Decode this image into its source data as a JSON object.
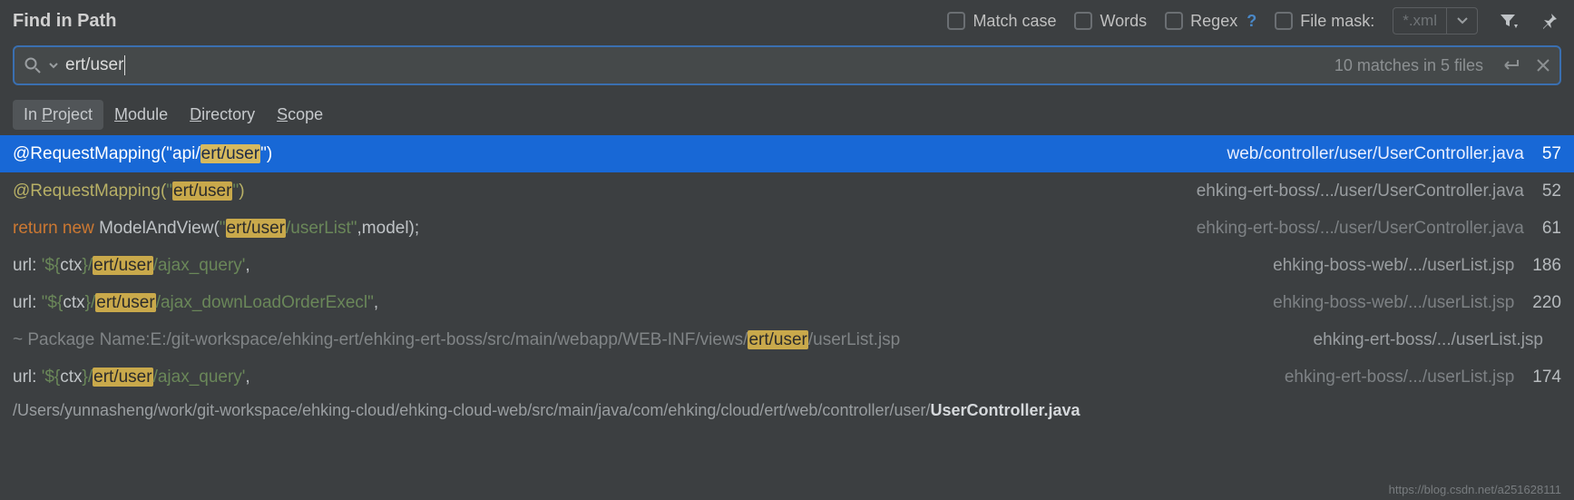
{
  "title": "Find in Path",
  "options": {
    "match_case": "Match case",
    "words": "Words",
    "regex": "Regex",
    "regex_help": "?",
    "file_mask_label": "File mask:",
    "file_mask_value": "*.xml"
  },
  "search": {
    "query": "ert/user",
    "summary": "10 matches in 5 files"
  },
  "tabs": [
    {
      "label_pre": "In ",
      "ul": "P",
      "label_post": "roject",
      "active": true
    },
    {
      "label_pre": "",
      "ul": "M",
      "label_post": "odule",
      "active": false
    },
    {
      "label_pre": "",
      "ul": "D",
      "label_post": "irectory",
      "active": false
    },
    {
      "label_pre": "",
      "ul": "S",
      "label_post": "cope",
      "active": false
    }
  ],
  "results": [
    {
      "selected": true,
      "segments": [
        {
          "t": "@RequestMapping(",
          "cls": "c-anno"
        },
        {
          "t": "\"api/",
          "cls": "c-str"
        },
        {
          "t": "ert/user",
          "cls": "hl"
        },
        {
          "t": "\"",
          "cls": "c-str"
        },
        {
          "t": ")",
          "cls": "c-anno"
        }
      ],
      "path": "web/controller/user/UserController.java",
      "line": "57"
    },
    {
      "segments": [
        {
          "t": "@RequestMapping(",
          "cls": "c-anno"
        },
        {
          "t": "\"",
          "cls": "c-str"
        },
        {
          "t": "ert/user",
          "cls": "hl"
        },
        {
          "t": "\"",
          "cls": "c-str"
        },
        {
          "t": ")",
          "cls": "c-anno"
        }
      ],
      "path": "ehking-ert-boss/.../user/UserController.java",
      "line": "52"
    },
    {
      "segments": [
        {
          "t": "return ",
          "cls": "c-kw"
        },
        {
          "t": "new ",
          "cls": "c-kw"
        },
        {
          "t": "ModelAndView(",
          "cls": "c-text"
        },
        {
          "t": "\"",
          "cls": "c-str"
        },
        {
          "t": "ert/user",
          "cls": "hl"
        },
        {
          "t": "/userList\"",
          "cls": "c-str"
        },
        {
          "t": ",model);",
          "cls": "c-text"
        }
      ],
      "path": "ehking-ert-boss/.../user/UserController.java",
      "line": "61",
      "path_fade": true
    },
    {
      "segments": [
        {
          "t": "url: ",
          "cls": "c-text"
        },
        {
          "t": "'${",
          "cls": "c-str"
        },
        {
          "t": "ctx",
          "cls": "c-text"
        },
        {
          "t": "}/",
          "cls": "c-str"
        },
        {
          "t": "ert/user",
          "cls": "hl"
        },
        {
          "t": "/ajax_query'",
          "cls": "c-str"
        },
        {
          "t": ",",
          "cls": "c-text"
        }
      ],
      "path": "ehking-boss-web/.../userList.jsp",
      "line": "186"
    },
    {
      "segments": [
        {
          "t": "url: ",
          "cls": "c-text"
        },
        {
          "t": "\"${",
          "cls": "c-str"
        },
        {
          "t": "ctx",
          "cls": "c-text"
        },
        {
          "t": "}/",
          "cls": "c-str"
        },
        {
          "t": "ert/user",
          "cls": "hl"
        },
        {
          "t": "/ajax_downLoadOrderExecl\"",
          "cls": "c-str"
        },
        {
          "t": ",",
          "cls": "c-text"
        }
      ],
      "path": "ehking-boss-web/.../userList.jsp",
      "line": "220",
      "path_fade": true
    },
    {
      "segments": [
        {
          "t": "  ~ Package Name:E:/git-workspace/ehking-ert/ehking-ert-boss/src/main/webapp/WEB-INF/views/",
          "cls": "c-fade"
        },
        {
          "t": "ert/user",
          "cls": "hl"
        },
        {
          "t": "/userList.jsp",
          "cls": "c-fade"
        }
      ],
      "path": "ehking-ert-boss/.../userList.jsp",
      "line": ""
    },
    {
      "segments": [
        {
          "t": "url: ",
          "cls": "c-text"
        },
        {
          "t": "'${",
          "cls": "c-str"
        },
        {
          "t": "ctx",
          "cls": "c-text"
        },
        {
          "t": "}/",
          "cls": "c-str"
        },
        {
          "t": "ert/user",
          "cls": "hl"
        },
        {
          "t": "/ajax_query'",
          "cls": "c-str"
        },
        {
          "t": ",",
          "cls": "c-text"
        }
      ],
      "path": "ehking-ert-boss/.../userList.jsp",
      "line": "174",
      "path_fade": true
    }
  ],
  "footer": {
    "prefix": "/Users/yunnasheng/work/git-workspace/ehking-cloud/ehking-cloud-web/src/main/java/com/ehking/cloud/ert/web/controller/user/",
    "bold": "UserController.java"
  },
  "watermark": "https://blog.csdn.net/a251628111"
}
